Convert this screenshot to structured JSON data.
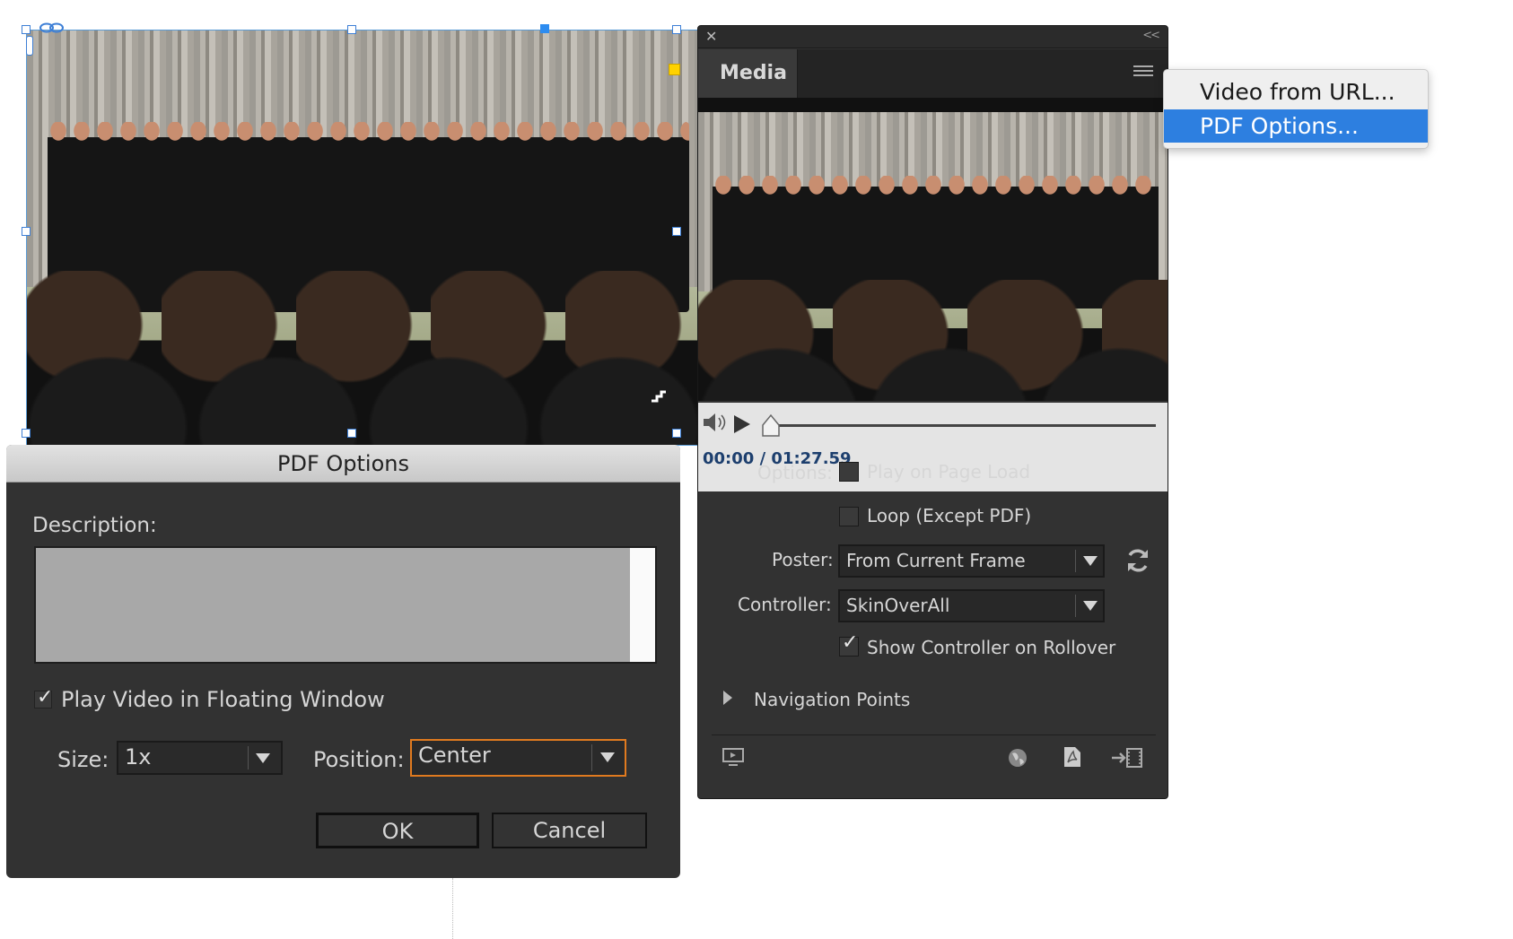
{
  "dialog": {
    "title": "PDF Options",
    "description_label": "Description:",
    "description_value": "",
    "floating_window_label": "Play Video in Floating Window",
    "floating_window_checked": true,
    "size_label": "Size:",
    "size_value": "1x",
    "position_label": "Position:",
    "position_value": "Center",
    "ok_label": "OK",
    "cancel_label": "Cancel"
  },
  "media_panel": {
    "close_glyph": "✕",
    "collapse_glyph": "<<",
    "tab_label": "Media",
    "timecode": "00:00 / 01:27.59",
    "options_label": "Options:",
    "play_on_load_label": "Play on Page Load",
    "play_on_load_checked": false,
    "loop_label": "Loop (Except PDF)",
    "loop_checked": false,
    "poster_label": "Poster:",
    "poster_value": "From Current Frame",
    "controller_label": "Controller:",
    "controller_value": "SkinOverAll",
    "show_controller_label": "Show Controller on Rollover",
    "show_controller_checked": true,
    "navigation_points_label": "Navigation Points",
    "playback_position": 0.0
  },
  "flyout_menu": {
    "items": [
      "Video from URL...",
      "PDF Options..."
    ],
    "selected_index": 1
  },
  "colors": {
    "accent_blue": "#2d7fe0",
    "focus_orange": "#e07a1f",
    "panel_bg": "#323232",
    "timecode": "#1d3f6e"
  },
  "icons": {
    "frame_link": "link-icon",
    "speaker": "speaker-icon",
    "play": "play-icon",
    "refresh": "refresh-icon",
    "panel_menu": "hamburger-icon",
    "footer": [
      "preview-icon",
      "globe-icon",
      "pdf-icon",
      "place-icon"
    ]
  }
}
